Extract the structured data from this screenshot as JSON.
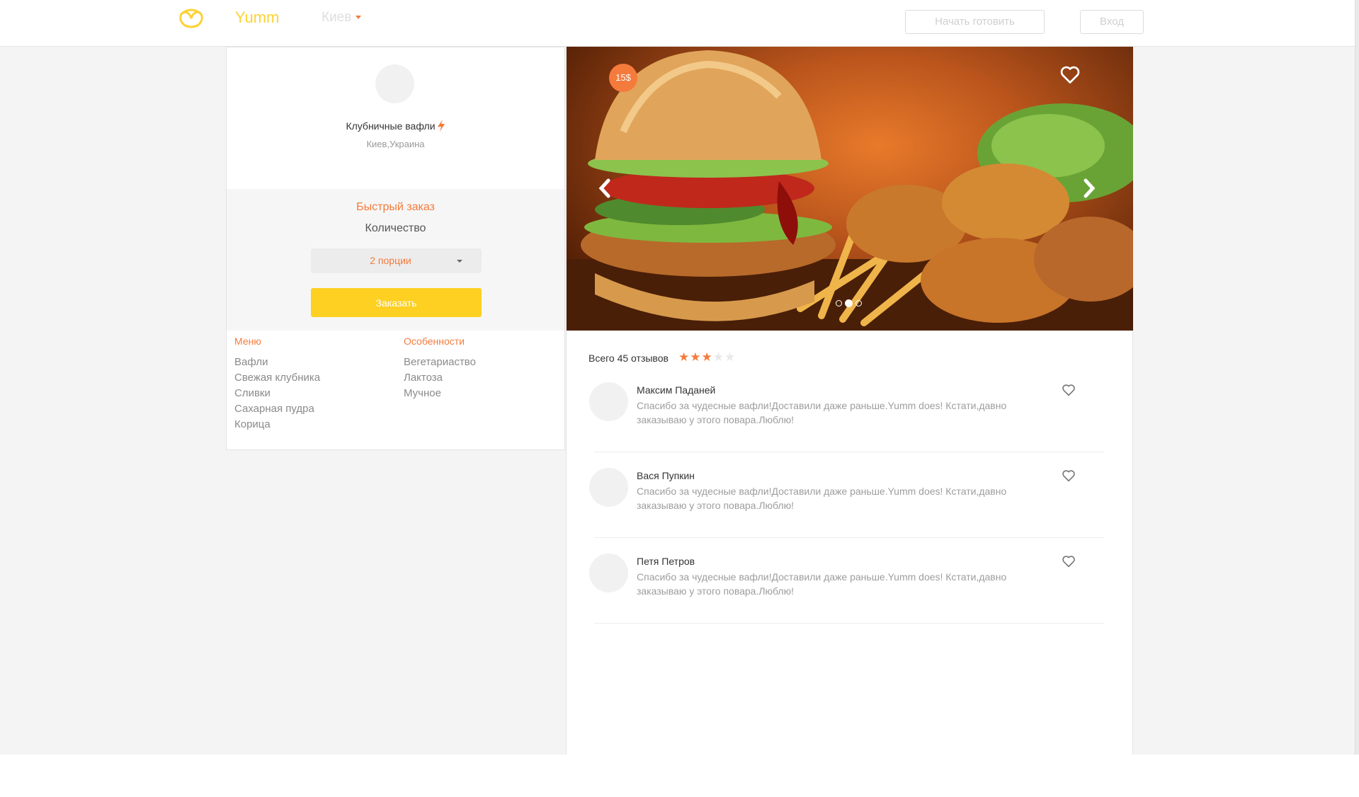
{
  "navbar": {
    "brand": "Yumm",
    "city": "Киев",
    "start_cooking_label": "Начать готовить",
    "login_label": "Вход"
  },
  "chef": {
    "title": "Клубничные вафли",
    "location": "Киев,Украина"
  },
  "quick_order": {
    "title": "Быстрый заказ",
    "quantity_label": "Количество",
    "portions_value": "2 порции",
    "order_button": "Заказать"
  },
  "menu": {
    "title": "Меню",
    "items": [
      "Вафли",
      "Свежая клубника",
      "Сливки",
      "Сахарная пудра",
      "Корица"
    ]
  },
  "features": {
    "title": "Особенности",
    "items": [
      "Вегетариаство",
      "Лактоза",
      "Мучное"
    ]
  },
  "gallery": {
    "price": "15$",
    "slides_total": 3,
    "active_slide": 2
  },
  "reviews": {
    "summary": "Всего 45 отзывов",
    "rating": 3,
    "rating_max": 5,
    "items": [
      {
        "name": "Максим Паданей",
        "text": "Спасибо за чудесные вафли!Доставили даже раньше.Yumm does! Кстати,давно заказываю у этого повара.Люблю!"
      },
      {
        "name": "Вася Пупкин",
        "text": "Спасибо за чудесные вафли!Доставили даже раньше.Yumm does! Кстати,давно заказываю у этого повара.Люблю!"
      },
      {
        "name": "Петя Петров",
        "text": "Спасибо за чудесные вафли!Доставили даже раньше.Yumm does! Кстати,давно заказываю у этого повара.Люблю!"
      }
    ]
  },
  "colors": {
    "brand_yellow": "#fdd235",
    "accent_orange": "#f47b3c",
    "button_yellow": "#fdd021"
  },
  "icons": [
    "logo-icon",
    "caret-down-icon",
    "bolt-icon",
    "heart-icon",
    "chevron-left-icon",
    "chevron-right-icon",
    "star-icon"
  ]
}
